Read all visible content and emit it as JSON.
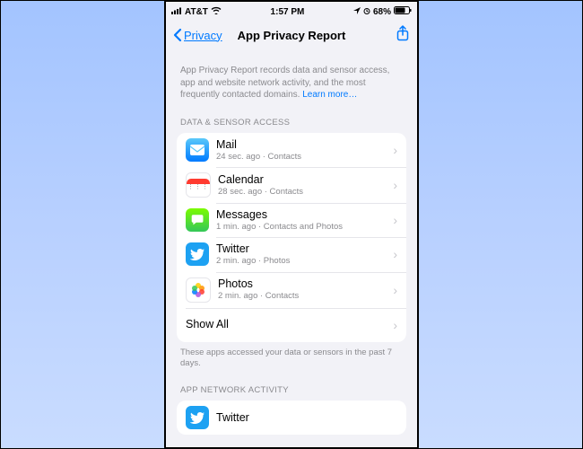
{
  "status": {
    "carrier": "AT&T",
    "time": "1:57 PM",
    "battery": "68%"
  },
  "nav": {
    "back_label": "Privacy",
    "title": "App Privacy Report"
  },
  "intro": {
    "text": "App Privacy Report records data and sensor access, app and website network activity, and the most frequently contacted domains.",
    "learn_more": "Learn more…"
  },
  "sections": {
    "data_sensor": {
      "header": "DATA & SENSOR ACCESS",
      "footer": "These apps accessed your data or sensors in the past 7 days.",
      "items": [
        {
          "name": "Mail",
          "sub": "24 sec. ago · Contacts",
          "icon": "mail"
        },
        {
          "name": "Calendar",
          "sub": "28 sec. ago · Contacts",
          "icon": "calendar"
        },
        {
          "name": "Messages",
          "sub": "1 min. ago · Contacts and Photos",
          "icon": "messages"
        },
        {
          "name": "Twitter",
          "sub": "2 min. ago · Photos",
          "icon": "twitter"
        },
        {
          "name": "Photos",
          "sub": "2 min. ago · Contacts",
          "icon": "photos"
        }
      ],
      "show_all": "Show All"
    },
    "network": {
      "header": "APP NETWORK ACTIVITY",
      "items": [
        {
          "name": "Twitter",
          "icon": "twitter"
        }
      ]
    }
  }
}
